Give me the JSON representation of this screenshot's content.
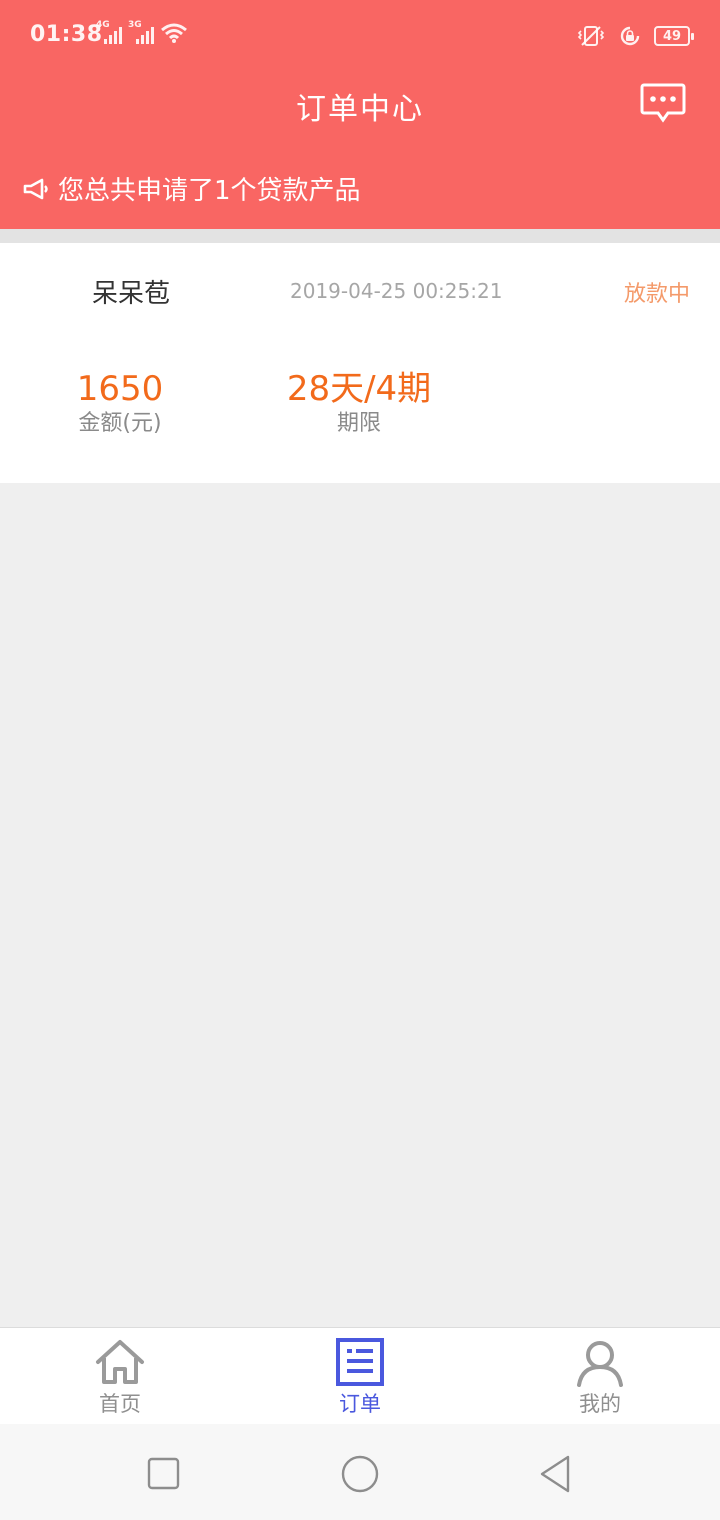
{
  "status_bar": {
    "time": "01:38",
    "network_1": "4G",
    "network_2": "3G",
    "battery": "49",
    "icons": [
      "signal-icon",
      "wifi-icon",
      "vibrate-icon",
      "rotation-lock-icon",
      "battery-icon"
    ]
  },
  "header": {
    "title": "订单中心",
    "message_icon": "chat-bubble-icon",
    "notice_icon": "megaphone-icon",
    "notice_text": "您总共申请了1个贷款产品"
  },
  "order": {
    "product_name": "呆呆苞",
    "time": "2019-04-25 00:25:21",
    "status": "放款中",
    "amount_value": "1650",
    "amount_label": "金额(元)",
    "term_value": "28天/4期",
    "term_label": "期限"
  },
  "tabs": [
    {
      "label": "首页",
      "icon": "home-icon",
      "active": false
    },
    {
      "label": "订单",
      "icon": "order-list-icon",
      "active": true
    },
    {
      "label": "我的",
      "icon": "user-icon",
      "active": false
    }
  ],
  "colors": {
    "header_bg": "#f96663",
    "accent_orange": "#f26a1b",
    "status_orange": "#f49a6a",
    "tab_active": "#4a58de",
    "tab_inactive": "#8f8f8f"
  }
}
